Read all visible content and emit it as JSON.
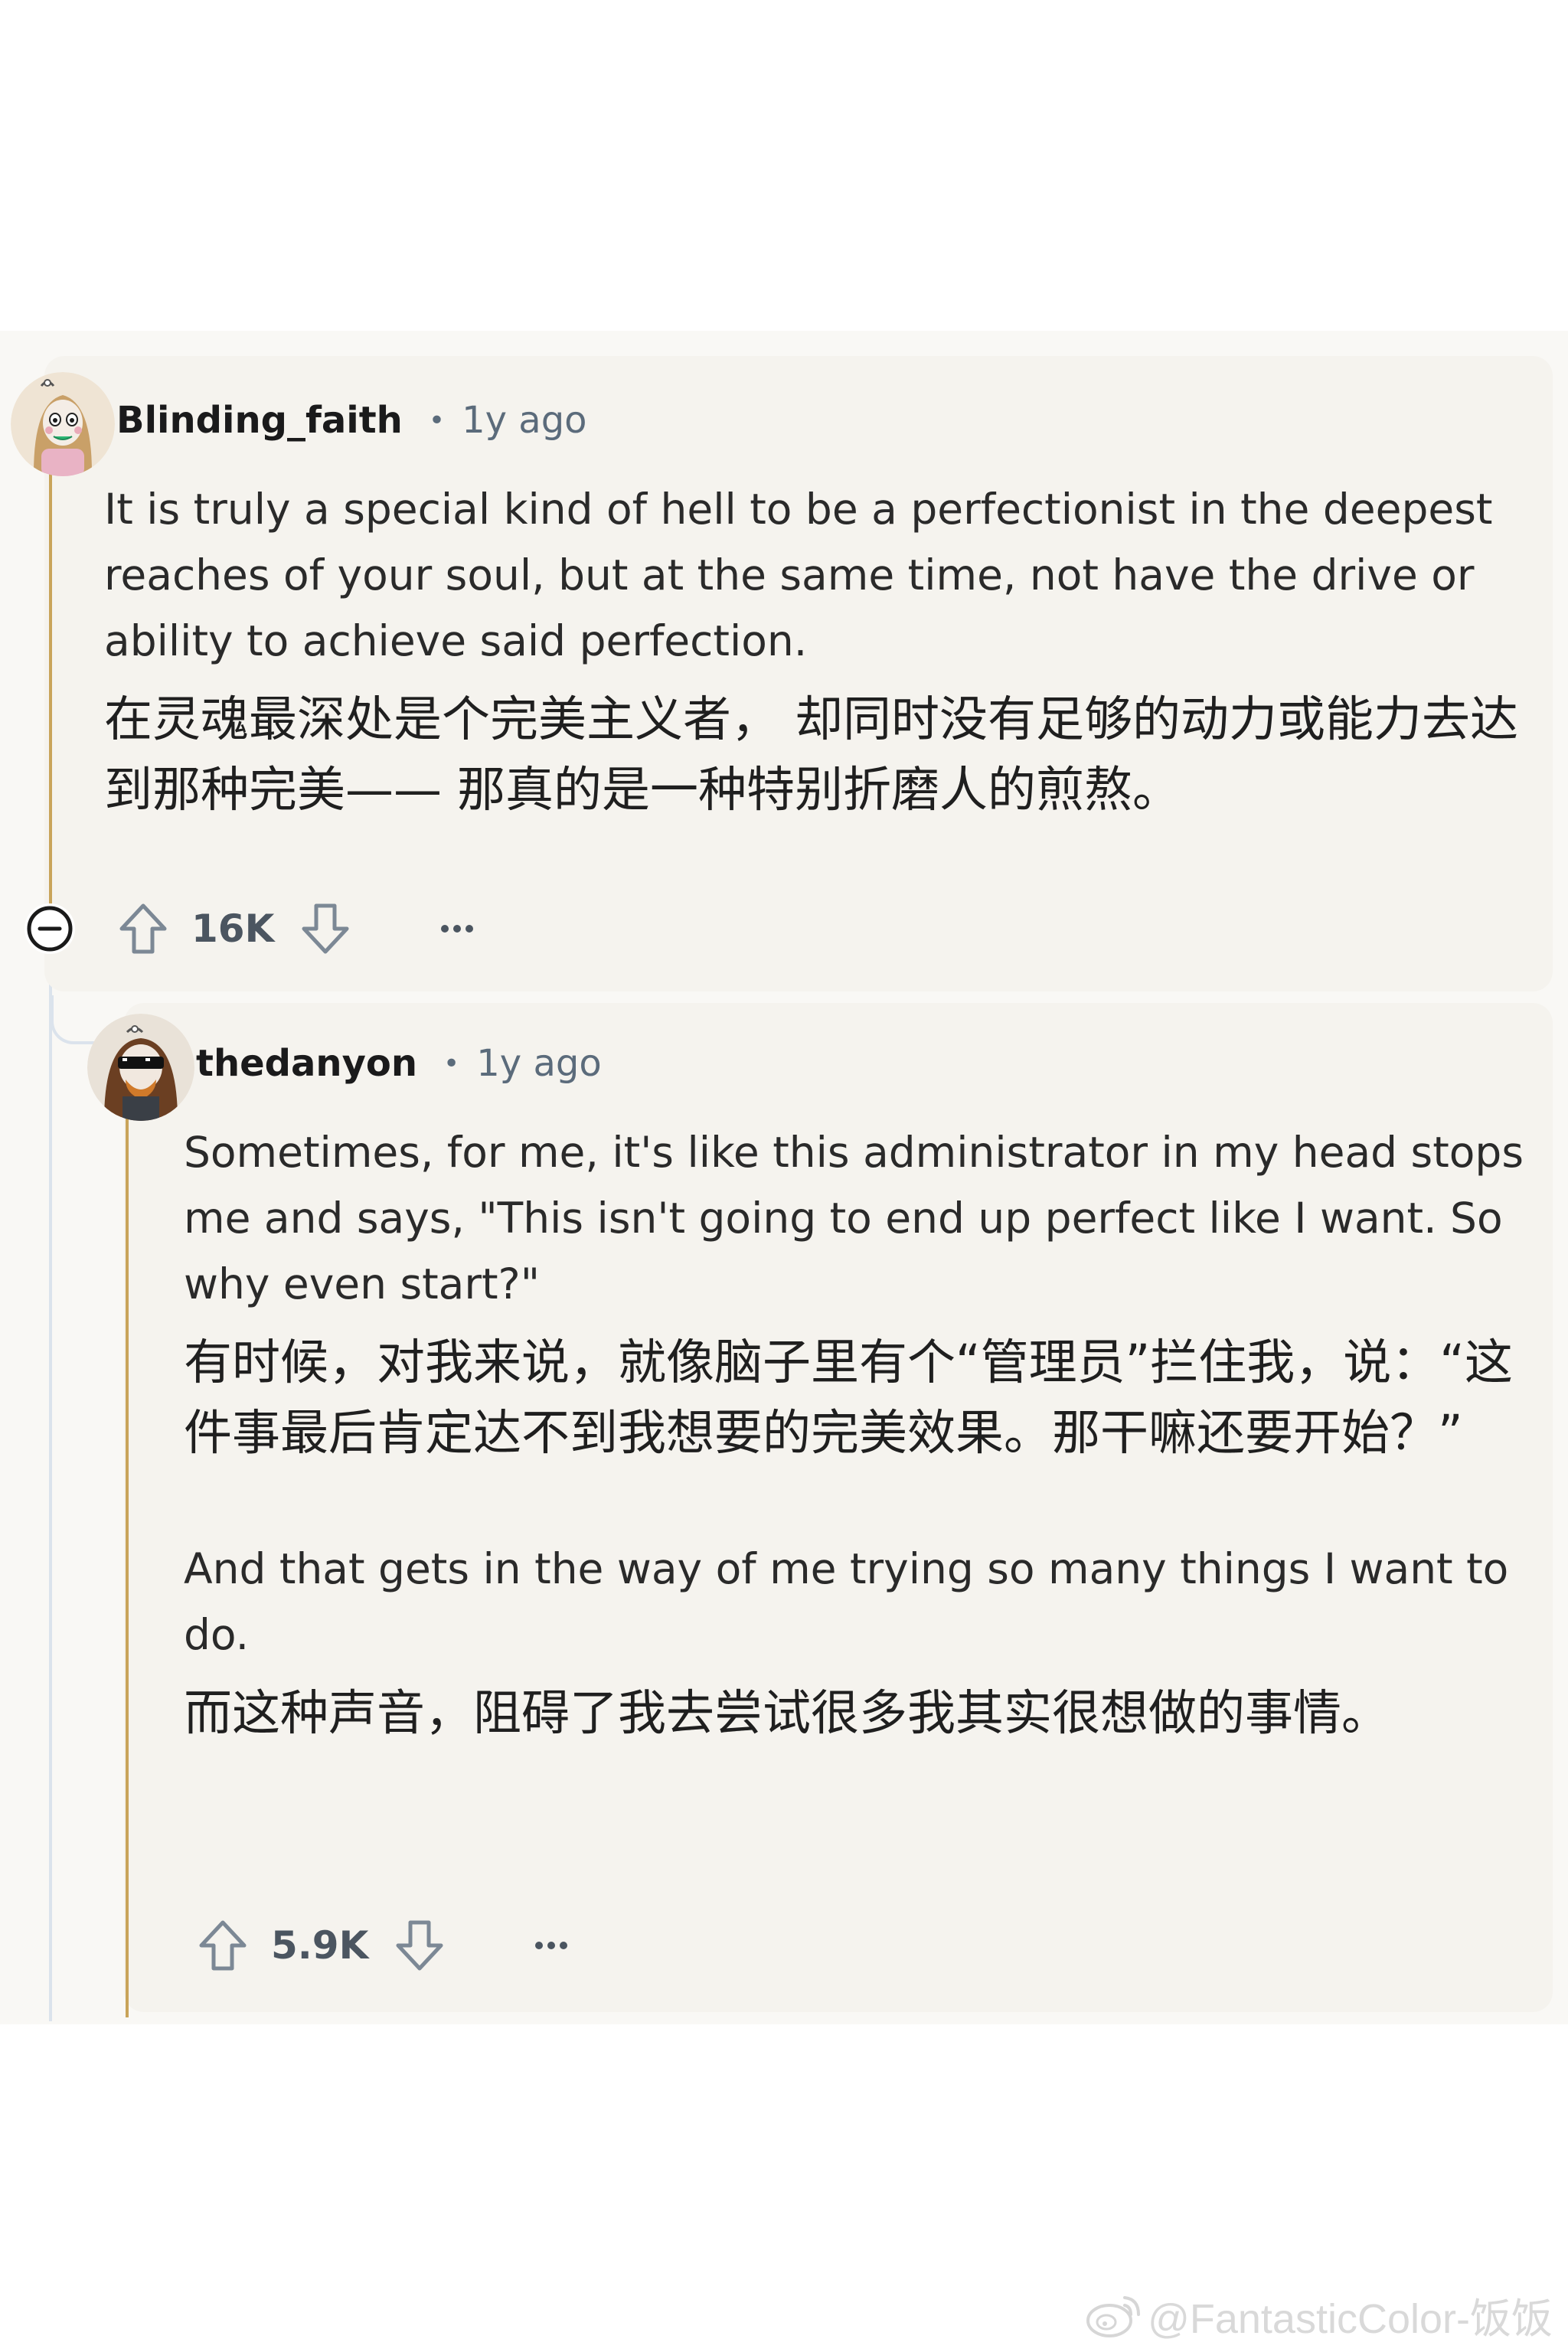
{
  "comments": [
    {
      "username": "Blinding_faith",
      "separator": "•",
      "time": "1y ago",
      "text_en": "It is truly a special kind of hell to be a perfectionist in the deepest reaches of your soul, but at the same time, not have the drive or ability to achieve said perfection.",
      "text_zh": "在灵魂最深处是个完美主义者， 却同时没有足够的动力或能力去达到那种完美—— 那真的是一种特别折磨人的煎熬。",
      "votes": "16K"
    },
    {
      "username": "thedanyon",
      "separator": "•",
      "time": "1y ago",
      "text_en": "Sometimes, for me, it's like this administrator in my head stops me and says, \"This isn't going to end up perfect like I want. So why even start?\"",
      "text_zh": "有时候，对我来说，就像脑子里有个“管理员”拦住我，说：“这件事最后肯定达不到我想要的完美效果。那干嘛还要开始？”",
      "text_en_2": "And that gets in the way of me trying so many things I want to do.",
      "text_zh_2": "而这种声音，阻碍了我去尝试很多我其实很想做的事情。",
      "votes": "5.9K"
    }
  ],
  "more_label": "···",
  "watermark": "@FantasticColor-饭饭",
  "colors": {
    "thread_line": "#c9a45a",
    "card_bg": "#f5f3ee",
    "meta_text": "#5b6b7b"
  },
  "icons": [
    "avatar-blinding-faith",
    "avatar-thedanyon",
    "upvote-icon",
    "downvote-icon",
    "more-options-icon",
    "collapse-icon",
    "weibo-icon"
  ]
}
